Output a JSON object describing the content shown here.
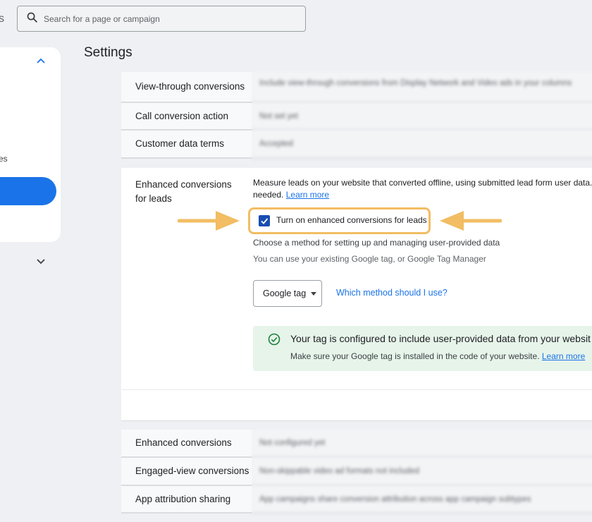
{
  "header": {
    "cut_label": "s",
    "search": {
      "placeholder": "Search for a page or campaign",
      "icon": "search-icon"
    }
  },
  "sidebar": {
    "collapse_icon": "chevron-up-icon",
    "expand_icon": "chevron-down-icon",
    "partial_label": "es",
    "active_color": "#1a73e8"
  },
  "page": {
    "title": "Settings"
  },
  "settings_rows_top": [
    {
      "label": "View-through conversions",
      "value": "Include view-through conversions from Display Network and Video ads in your columns"
    },
    {
      "label": "Call conversion action",
      "value": "Not set yet"
    },
    {
      "label": "Customer data terms",
      "value": "Accepted"
    }
  ],
  "enhanced_leads": {
    "label": "Enhanced conversions for leads",
    "description": "Measure leads on your website that converted offline, using submitted lead form user data.",
    "description_cont": "needed.",
    "learn_more": "Learn more",
    "checkbox_label": "Turn on enhanced conversions for leads",
    "checkbox_checked": true,
    "method_heading": "Choose a method for setting up and managing user-provided data",
    "method_sub": "You can use your existing Google tag, or Google Tag Manager",
    "method_selected": "Google tag",
    "method_help_link": "Which method should I use?",
    "status_title": "Your tag is configured to include user-provided data from your websit",
    "status_sub": "Make sure your Google tag is installed in the code of your website.",
    "status_learn_more": "Learn more",
    "status_icon": "check-circle-icon",
    "highlight_color": "#f2bd63",
    "success_bg": "#e6f4ea"
  },
  "settings_rows_bottom": [
    {
      "label": "Enhanced conversions",
      "value": "Not configured yet"
    },
    {
      "label": "Engaged-view conversions",
      "value": "Non-skippable video ad formats not included"
    },
    {
      "label": "App attribution sharing",
      "value": "App campaigns share conversion attribution across app campaign subtypes"
    }
  ]
}
